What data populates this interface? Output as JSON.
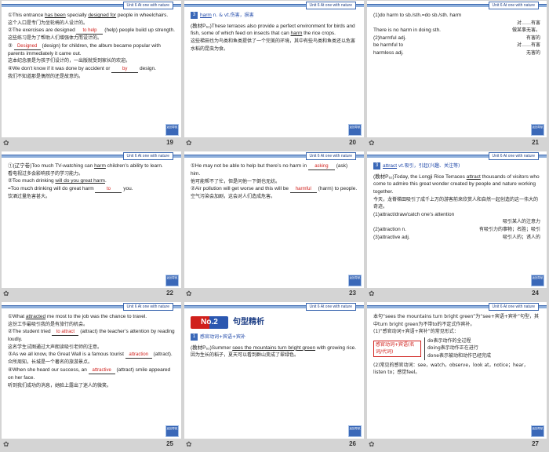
{
  "header_tag": "Unit 6   At one with nature",
  "badge": "返回导航",
  "footer_star": "✿",
  "slides": [
    {
      "num": "19",
      "lines": [
        {
          "pre": "①This entrance ",
          "u1": "has been",
          "mid": " specially ",
          "u2": "designed for",
          "post": " people in wheelchairs."
        },
        {
          "cn": "这个入口是专门为坐轮椅的人设计的。"
        },
        {
          "pre": "②The exercises are designed ",
          "blank": "to help",
          "post": " (help) people build up strength."
        },
        {
          "cn": "这些练习是为了帮助人们增强体力而设计的。"
        },
        {
          "pre": "③ ",
          "blank": "Designed",
          "post": " (design) for children, the album became popular with parents immediately it came out."
        },
        {
          "cn": "这本纪念册是为孩子们设计的，一出版就受到家长的欢迎。"
        },
        {
          "pre": "④We don’t know if it was done by accident or ",
          "blank": "by",
          "post": " design."
        },
        {
          "cn": "我们不知道那是偶然的还是故意的。"
        }
      ]
    },
    {
      "num": "20",
      "head_word": "harm",
      "head_pos": "n. & vt.伤害，损害",
      "para": "(教材P₆₂)These terraces also provide a perfect environment for birds and fish, some of which feed on insects that can ",
      "para_u": "harm",
      "para_post": " the rice crops.",
      "cn": "这些梯田也为鸟类和鱼类提供了一个完美的环境，其中有些鸟类和鱼类还以危害水稻的昆虫为食。"
    },
    {
      "num": "21",
      "l1": "(1)do harm to sb./sth.=do sb./sth. harm",
      "l1b": "对……有害",
      "rows": [
        {
          "left": "There is no harm in doing sth.",
          "right": "做某事无害。"
        },
        {
          "left": "(2)harmful adj.",
          "right": "有害的"
        },
        {
          "left": "be harmful to",
          "right": "对……有害"
        },
        {
          "left": "harmless adj.",
          "right": "无害的"
        }
      ]
    },
    {
      "num": "22",
      "lines": [
        {
          "pre": "①(辽宁卷)Too much TV-watching can ",
          "u1": "harm",
          "post": " children’s ability to learn."
        },
        {
          "cn": "看电视过多会影响孩子的学习能力。"
        },
        {
          "pre": "②Too much drinking ",
          "u1": "will do you great harm",
          "post": "."
        },
        {
          "pre": "=Too much drinking will do great harm ",
          "blank": "to",
          "post": " you."
        },
        {
          "cn": "饮酒过量危害甚大。"
        }
      ]
    },
    {
      "num": "23",
      "lines": [
        {
          "pre": "①He may not be able to help but there’s no harm in ",
          "blank": "asking",
          "post": " (ask) him."
        },
        {
          "cn": "他可能帮不了忙，但是问他一下倒也无妨。"
        },
        {
          "pre": "②Air pollution will get worse and this will be ",
          "blank": "harmful",
          "post": " (harm) to people."
        },
        {
          "cn": "空气污染会加剧，这会对人们造成危害。"
        }
      ]
    },
    {
      "num": "24",
      "head_word": "attract",
      "head_pos": "vt.吸引，引起(兴趣、关注等)",
      "para": "(教材P₆₂)Today, the Longji Rice Terraces ",
      "para_u": "attract",
      "para_post": " thousands of visitors who come to admire this great wonder created by people and nature working together.",
      "cn": "今天，龙脊梯田吸引了成千上万的游客前来欣赏人和自然一起创造的这一伟大的奇迹。",
      "l1": "(1)attract/draw/catch one’s attention",
      "rows": [
        {
          "left": "",
          "right": "吸引某人的注意力"
        },
        {
          "left": "(2)attraction n.",
          "right": "有吸引力的事物；名胜；吸引"
        },
        {
          "left": "(3)attractive adj.",
          "right": "吸引人的；诱人的"
        }
      ]
    },
    {
      "num": "25",
      "lines": [
        {
          "pre": "①What ",
          "u1": "attracted",
          "post": " me most to the job was the chance to travel."
        },
        {
          "cn": "这份工作最吸引我的是有旅行的机会。"
        },
        {
          "pre": "②The student tried ",
          "blank": "to attract",
          "post": " (attract) the teacher’s attention by reading loudly."
        },
        {
          "cn": "这名学生试图通过大声朗读吸引老师的注意。"
        },
        {
          "pre": "③As we all know, the Great Wall is a famous tourist ",
          "blank": "attraction",
          "post": " (attract)."
        },
        {
          "cn": "众所周知，长城是一个著名的旅游景点。"
        },
        {
          "pre": "④When she heard our success, an ",
          "blank": "attractive",
          "post": " (attract) smile appeared on her face."
        },
        {
          "cn": "听到我们成功的消息，她脸上露出了迷人的微笑。"
        }
      ]
    },
    {
      "num": "26",
      "sec_num": "No.2",
      "sec_title": "句型精析",
      "sub_icon": "1",
      "sub_title": "感官动词+宾语+宾补",
      "para": "(教材P₆₂)Summer ",
      "para_u": "sees the mountains turn bright green",
      "para_post": " with growing rice.",
      "cn": "因为生长的稻子，夏天可以看到群山变成了翠绿色。"
    },
    {
      "num": "27",
      "intro": "本句“sees the mountains turn bright green”为“see+宾语+宾补”句型，其中turn bright green为不带to的不定式作宾补。",
      "pat_title": "(1)“感官动词+宾语+宾补”的常见形式：",
      "pat_box": "感官动词+宾语(名词/代词)",
      "pat_items": [
        "do表示动作的全过程",
        "doing表示动作正在进行",
        "done表示被动和动作已经完成"
      ],
      "verbs": "(2)常见的感官动词：see，watch，observe，look at，notice；hear，listen to；感觉feel。"
    }
  ]
}
